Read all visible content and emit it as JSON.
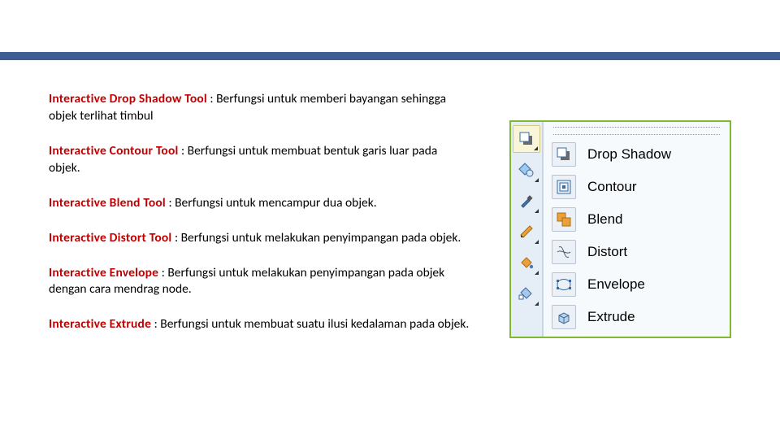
{
  "tools": [
    {
      "title": "Interactive Drop Shadow Tool",
      "desc": ": Berfungsi untuk memberi bayangan sehingga objek terlihat timbul"
    },
    {
      "title": "Interactive Contour Tool",
      "desc": ": Berfungsi untuk membuat bentuk garis luar pada objek."
    },
    {
      "title": "Interactive Blend Tool",
      "desc": ": Berfungsi untuk mencampur dua objek."
    },
    {
      "title": "Interactive Distort Tool",
      "desc": ": Berfungsi untuk melakukan penyimpangan pada objek."
    },
    {
      "title": "Interactive Envelope",
      "desc": ": Berfungsi untuk melakukan penyimpangan pada objek dengan cara mendrag node."
    },
    {
      "title": "Interactive Extrude",
      "desc": ": Berfungsi untuk membuat suatu ilusi kedalaman pada objek."
    }
  ],
  "flyout_labels": {
    "drop_shadow": "Drop Shadow",
    "contour": "Contour",
    "blend": "Blend",
    "distort": "Distort",
    "envelope": "Envelope",
    "extrude": "Extrude"
  },
  "colors": {
    "rule": "#3f5e94",
    "accent_border": "#7fba2e",
    "title": "#c00000"
  }
}
